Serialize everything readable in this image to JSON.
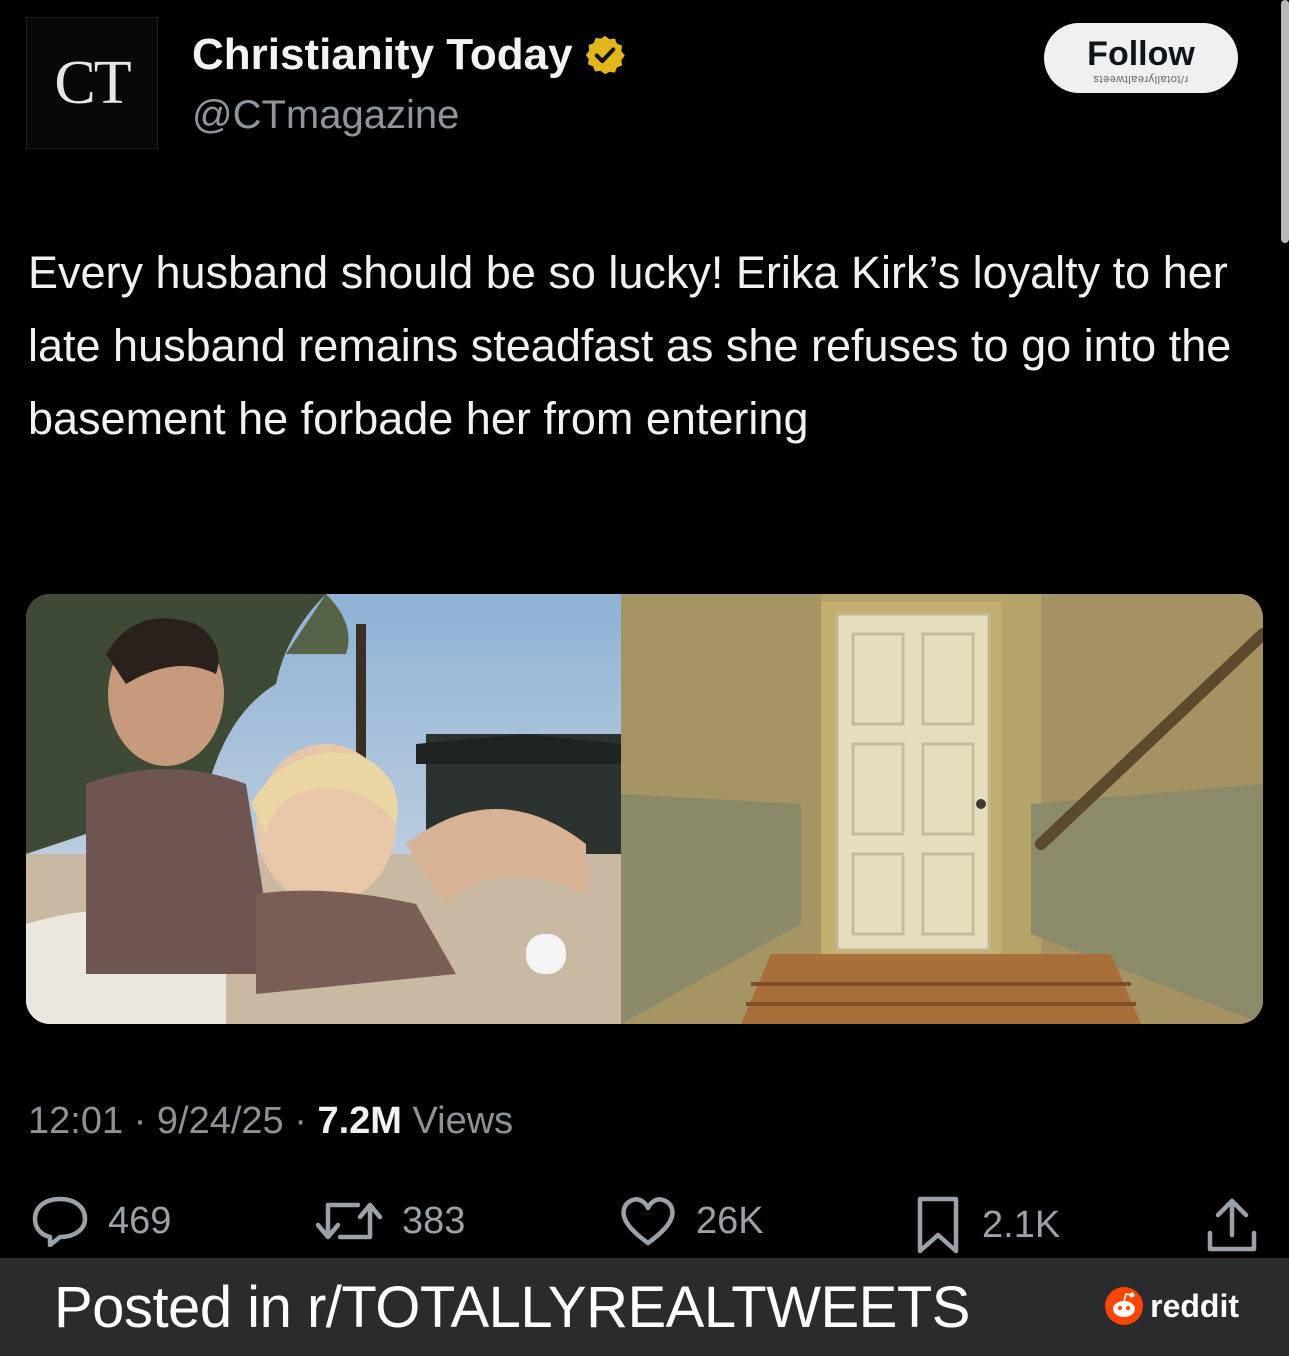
{
  "account": {
    "avatar_text": "CT",
    "name": "Christianity Today",
    "handle": "@CTmagazine",
    "follow_label": "Follow",
    "watermark": "r/totallyrealtweets"
  },
  "tweet": {
    "text": "Every husband should be so lucky! Erika Kirk’s loyalty to her late husband remains steadfast as she refuses to go into the basement he forbade her from entering",
    "time": "12:01",
    "date": "9/24/25",
    "views_count": "7.2M",
    "views_label": "Views",
    "sep": "·"
  },
  "actions": {
    "replies": "469",
    "retweets": "383",
    "likes": "26K",
    "bookmarks": "2.1K"
  },
  "footer": {
    "posted_in": "Posted in r/TOTALLYREALTWEETS",
    "brand": "reddit"
  },
  "colors": {
    "verified_badge": "#e2b719",
    "muted_text": "#8b9298",
    "footer_bg": "#2a2b2d",
    "reddit_orange": "#ff4500"
  }
}
